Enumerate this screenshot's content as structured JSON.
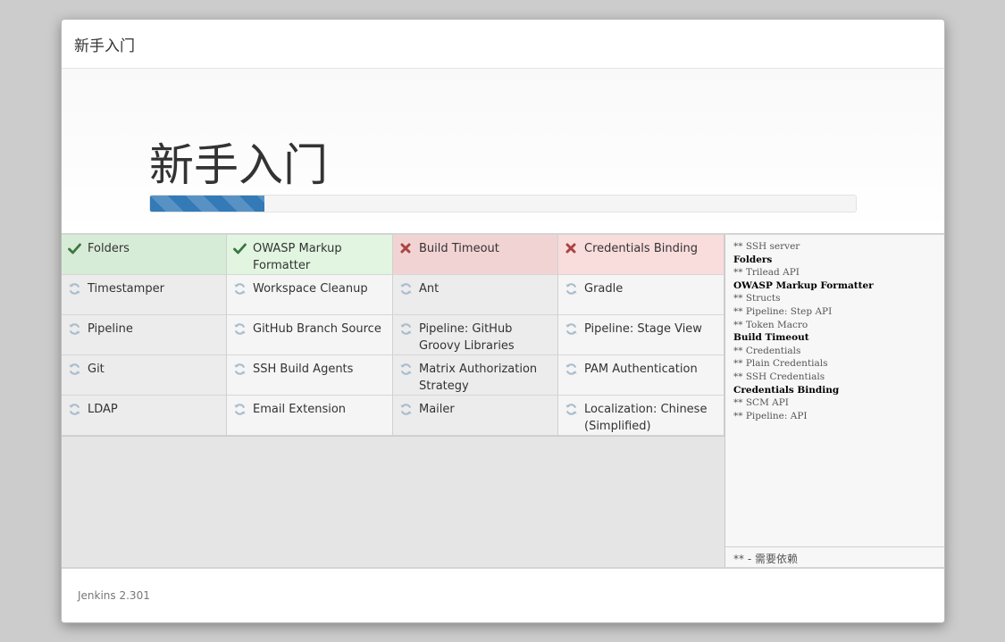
{
  "header": {
    "title": "新手入门"
  },
  "hero": {
    "title": "新手入门",
    "progress_fraction": 0.162
  },
  "colors": {
    "success_check": "#3c763d",
    "fail_x": "#a94442",
    "pending_icon": "#a9bccd",
    "progress": "#337ab7"
  },
  "plugins": [
    {
      "name": "Folders",
      "status": "success"
    },
    {
      "name": "OWASP Markup Formatter",
      "status": "success"
    },
    {
      "name": "Build Timeout",
      "status": "fail"
    },
    {
      "name": "Credentials Binding",
      "status": "fail"
    },
    {
      "name": "Timestamper",
      "status": "pending"
    },
    {
      "name": "Workspace Cleanup",
      "status": "pending"
    },
    {
      "name": "Ant",
      "status": "pending"
    },
    {
      "name": "Gradle",
      "status": "pending"
    },
    {
      "name": "Pipeline",
      "status": "pending"
    },
    {
      "name": "GitHub Branch Source",
      "status": "pending"
    },
    {
      "name": "Pipeline: GitHub Groovy Libraries",
      "status": "pending"
    },
    {
      "name": "Pipeline: Stage View",
      "status": "pending"
    },
    {
      "name": "Git",
      "status": "pending"
    },
    {
      "name": "SSH Build Agents",
      "status": "pending"
    },
    {
      "name": "Matrix Authorization Strategy",
      "status": "pending"
    },
    {
      "name": "PAM Authentication",
      "status": "pending"
    },
    {
      "name": "LDAP",
      "status": "pending"
    },
    {
      "name": "Email Extension",
      "status": "pending"
    },
    {
      "name": "Mailer",
      "status": "pending"
    },
    {
      "name": "Localization: Chinese (Simplified)",
      "status": "pending"
    }
  ],
  "log": {
    "lines": [
      {
        "text": "** SSH server",
        "kind": "dep"
      },
      {
        "text": "Folders",
        "kind": "main"
      },
      {
        "text": "** Trilead API",
        "kind": "dep"
      },
      {
        "text": "OWASP Markup Formatter",
        "kind": "main"
      },
      {
        "text": "** Structs",
        "kind": "dep"
      },
      {
        "text": "** Pipeline: Step API",
        "kind": "dep"
      },
      {
        "text": "** Token Macro",
        "kind": "dep"
      },
      {
        "text": "Build Timeout",
        "kind": "main"
      },
      {
        "text": "** Credentials",
        "kind": "dep"
      },
      {
        "text": "** Plain Credentials",
        "kind": "dep"
      },
      {
        "text": "** SSH Credentials",
        "kind": "dep"
      },
      {
        "text": "Credentials Binding",
        "kind": "main"
      },
      {
        "text": "** SCM API",
        "kind": "dep"
      },
      {
        "text": "** Pipeline: API",
        "kind": "dep"
      }
    ],
    "footer": "** - 需要依赖"
  },
  "footer": {
    "version": "Jenkins 2.301"
  }
}
